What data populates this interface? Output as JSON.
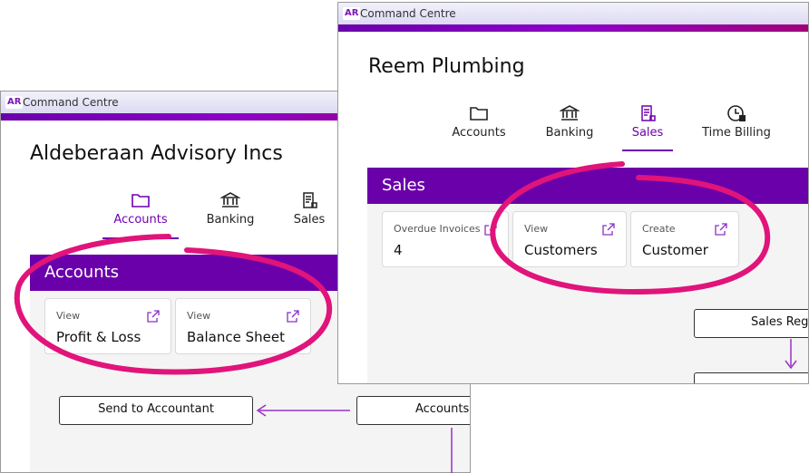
{
  "windows": {
    "back": {
      "logo": "AR",
      "title": "Command Centre",
      "business_name": "Aldeberaan Advisory Incs",
      "tabs": [
        {
          "label": "Accounts",
          "icon": "folder-icon",
          "active": true
        },
        {
          "label": "Banking",
          "icon": "bank-icon"
        },
        {
          "label": "Sales",
          "icon": "invoice-icon"
        }
      ],
      "section_title": "Accounts",
      "cards": [
        {
          "small": "View",
          "big": "Profit & Loss"
        },
        {
          "small": "View",
          "big": "Balance Sheet"
        }
      ],
      "flow": {
        "send_to_accountant": "Send to Accountant",
        "accounts": "Accounts"
      }
    },
    "front": {
      "logo": "AR",
      "title": "Command Centre",
      "business_name": "Reem Plumbing",
      "tabs": [
        {
          "label": "Accounts",
          "icon": "folder-icon"
        },
        {
          "label": "Banking",
          "icon": "bank-icon"
        },
        {
          "label": "Sales",
          "icon": "invoice-icon",
          "active": true
        },
        {
          "label": "Time Billing",
          "icon": "clock-icon"
        }
      ],
      "section_title": "Sales",
      "cards": [
        {
          "small": "Overdue Invoices",
          "big": "4"
        },
        {
          "small": "View",
          "big": "Customers"
        },
        {
          "small": "Create",
          "big": "Customer"
        }
      ],
      "flow": {
        "sales_register": "Sales Register"
      }
    }
  },
  "colors": {
    "brand_purple": "#6a00aa",
    "annotation_pink": "#e0147a",
    "arrow_purple": "#9a30c8"
  }
}
